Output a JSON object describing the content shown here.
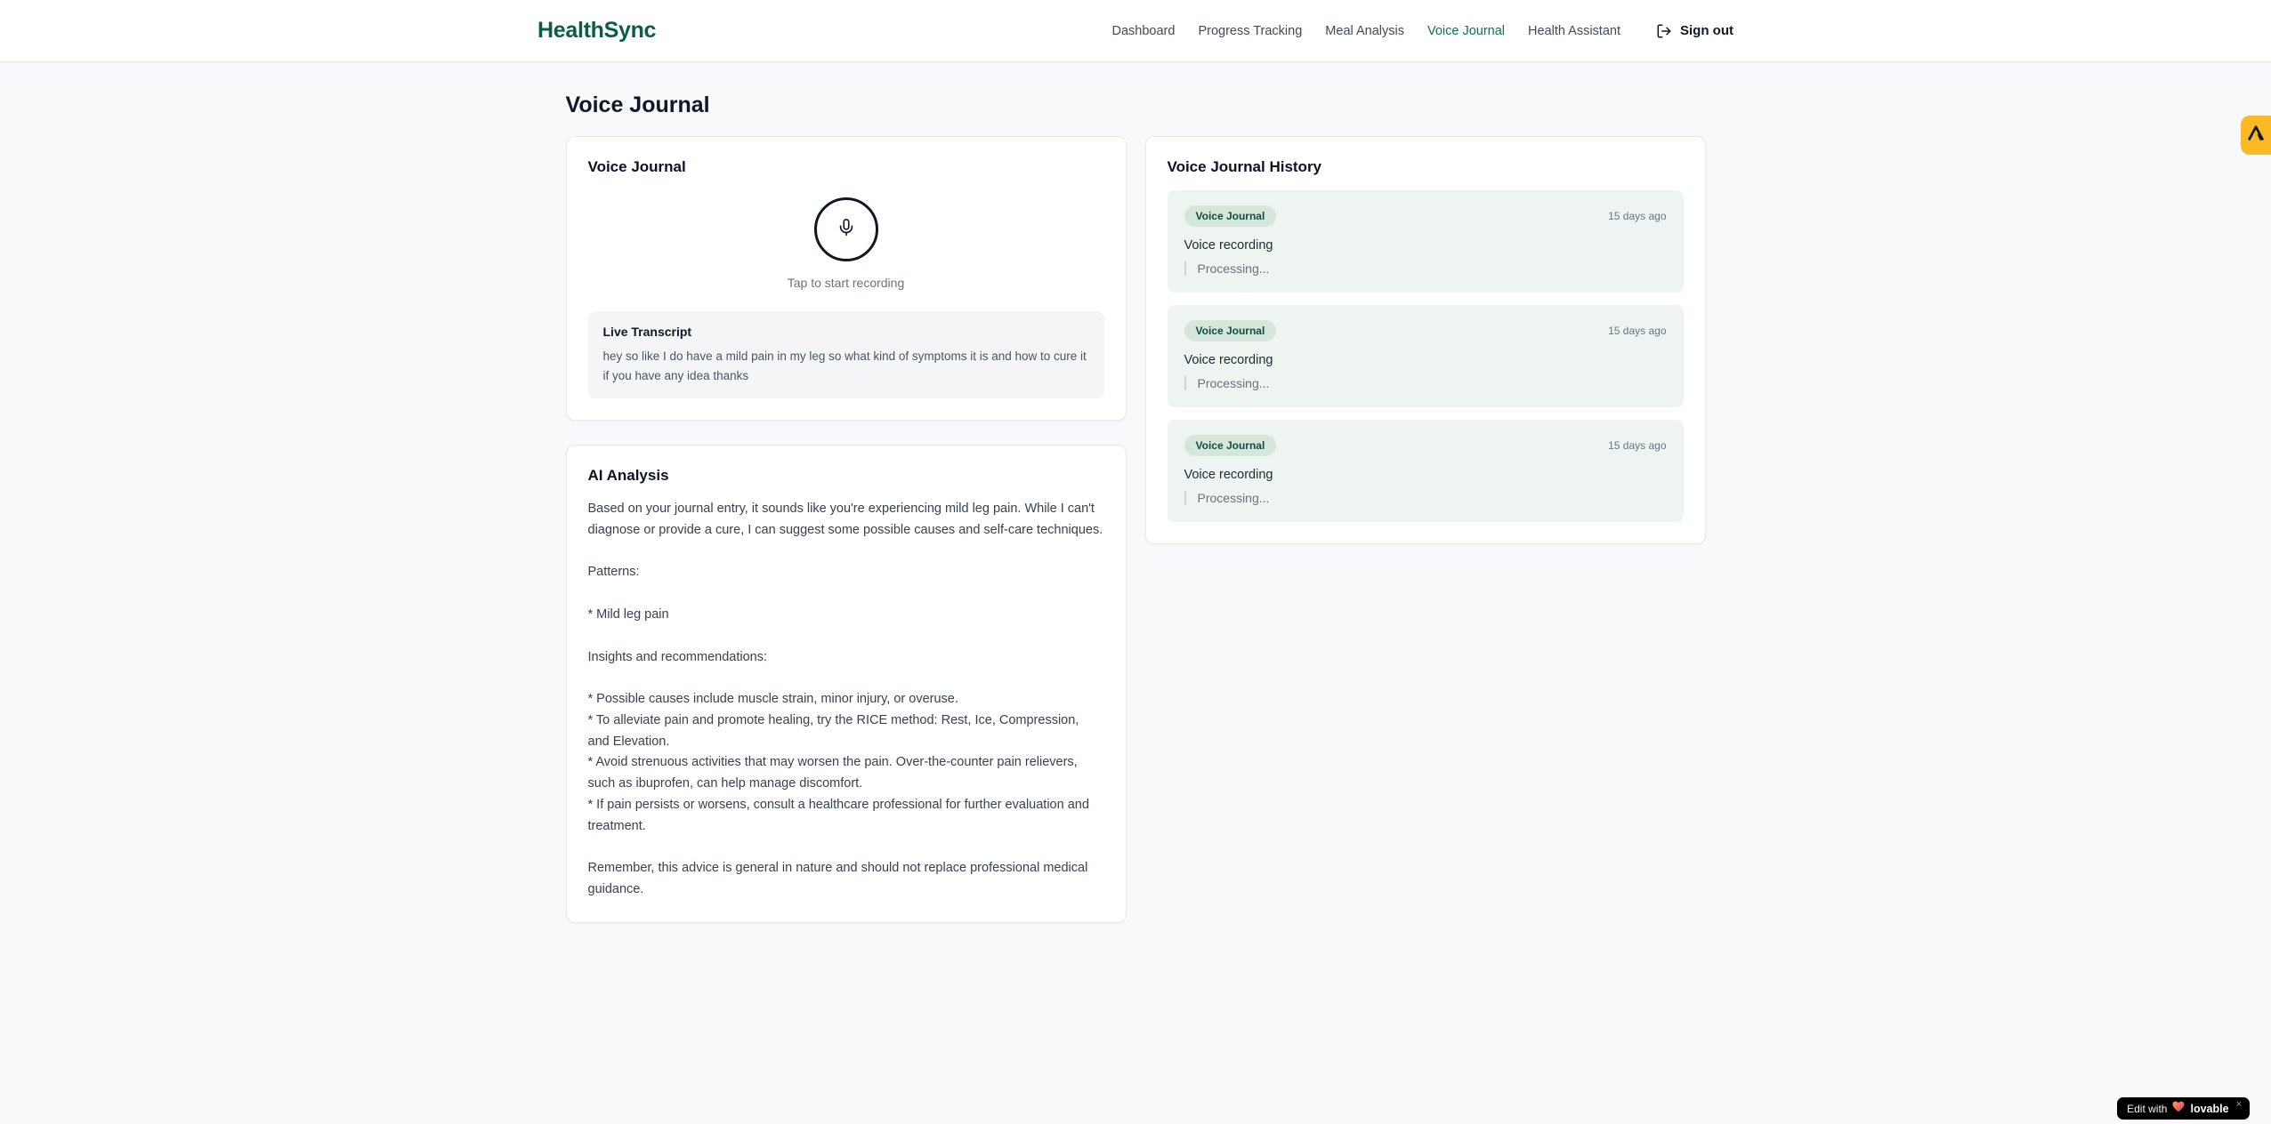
{
  "header": {
    "logo": "HealthSync",
    "nav": [
      {
        "label": "Dashboard"
      },
      {
        "label": "Progress Tracking"
      },
      {
        "label": "Meal Analysis"
      },
      {
        "label": "Voice Journal"
      },
      {
        "label": "Health Assistant"
      }
    ],
    "sign_out_label": "Sign out"
  },
  "page": {
    "title": "Voice Journal"
  },
  "recorder": {
    "card_title": "Voice Journal",
    "tap_hint": "Tap to start recording",
    "transcript_title": "Live Transcript",
    "transcript_text": "hey so like I do have a mild pain in my leg so what kind of symptoms it is and how to cure it if you have any idea thanks"
  },
  "analysis": {
    "card_title": "AI Analysis",
    "body": "Based on your journal entry, it sounds like you're experiencing mild leg pain. While I can't diagnose or provide a cure, I can suggest some possible causes and self-care techniques.\n\nPatterns:\n\n* Mild leg pain\n\nInsights and recommendations:\n\n* Possible causes include muscle strain, minor injury, or overuse.\n* To alleviate pain and promote healing, try the RICE method: Rest, Ice, Compression, and Elevation.\n* Avoid strenuous activities that may worsen the pain. Over-the-counter pain relievers, such as ibuprofen, can help manage discomfort.\n* If pain persists or worsens, consult a healthcare professional for further evaluation and treatment.\n\nRemember, this advice is general in nature and should not replace professional medical guidance."
  },
  "history": {
    "card_title": "Voice Journal History",
    "items": [
      {
        "badge": "Voice Journal",
        "time": "15 days ago",
        "title": "Voice recording",
        "status": "Processing..."
      },
      {
        "badge": "Voice Journal",
        "time": "15 days ago",
        "title": "Voice recording",
        "status": "Processing..."
      },
      {
        "badge": "Voice Journal",
        "time": "15 days ago",
        "title": "Voice recording",
        "status": "Processing..."
      }
    ]
  },
  "lovable": {
    "edit_with": "Edit with",
    "brand": "lovable",
    "close": "×"
  },
  "colors": {
    "brand_teal": "#0c5c4c",
    "nav_active": "#0e6e5c",
    "history_item_bg": "#eef5f0",
    "history_badge_bg": "#d7e6db",
    "history_badge_text": "#0d4f43",
    "side_tab": "#fbba25",
    "pill_bg": "#000000"
  }
}
